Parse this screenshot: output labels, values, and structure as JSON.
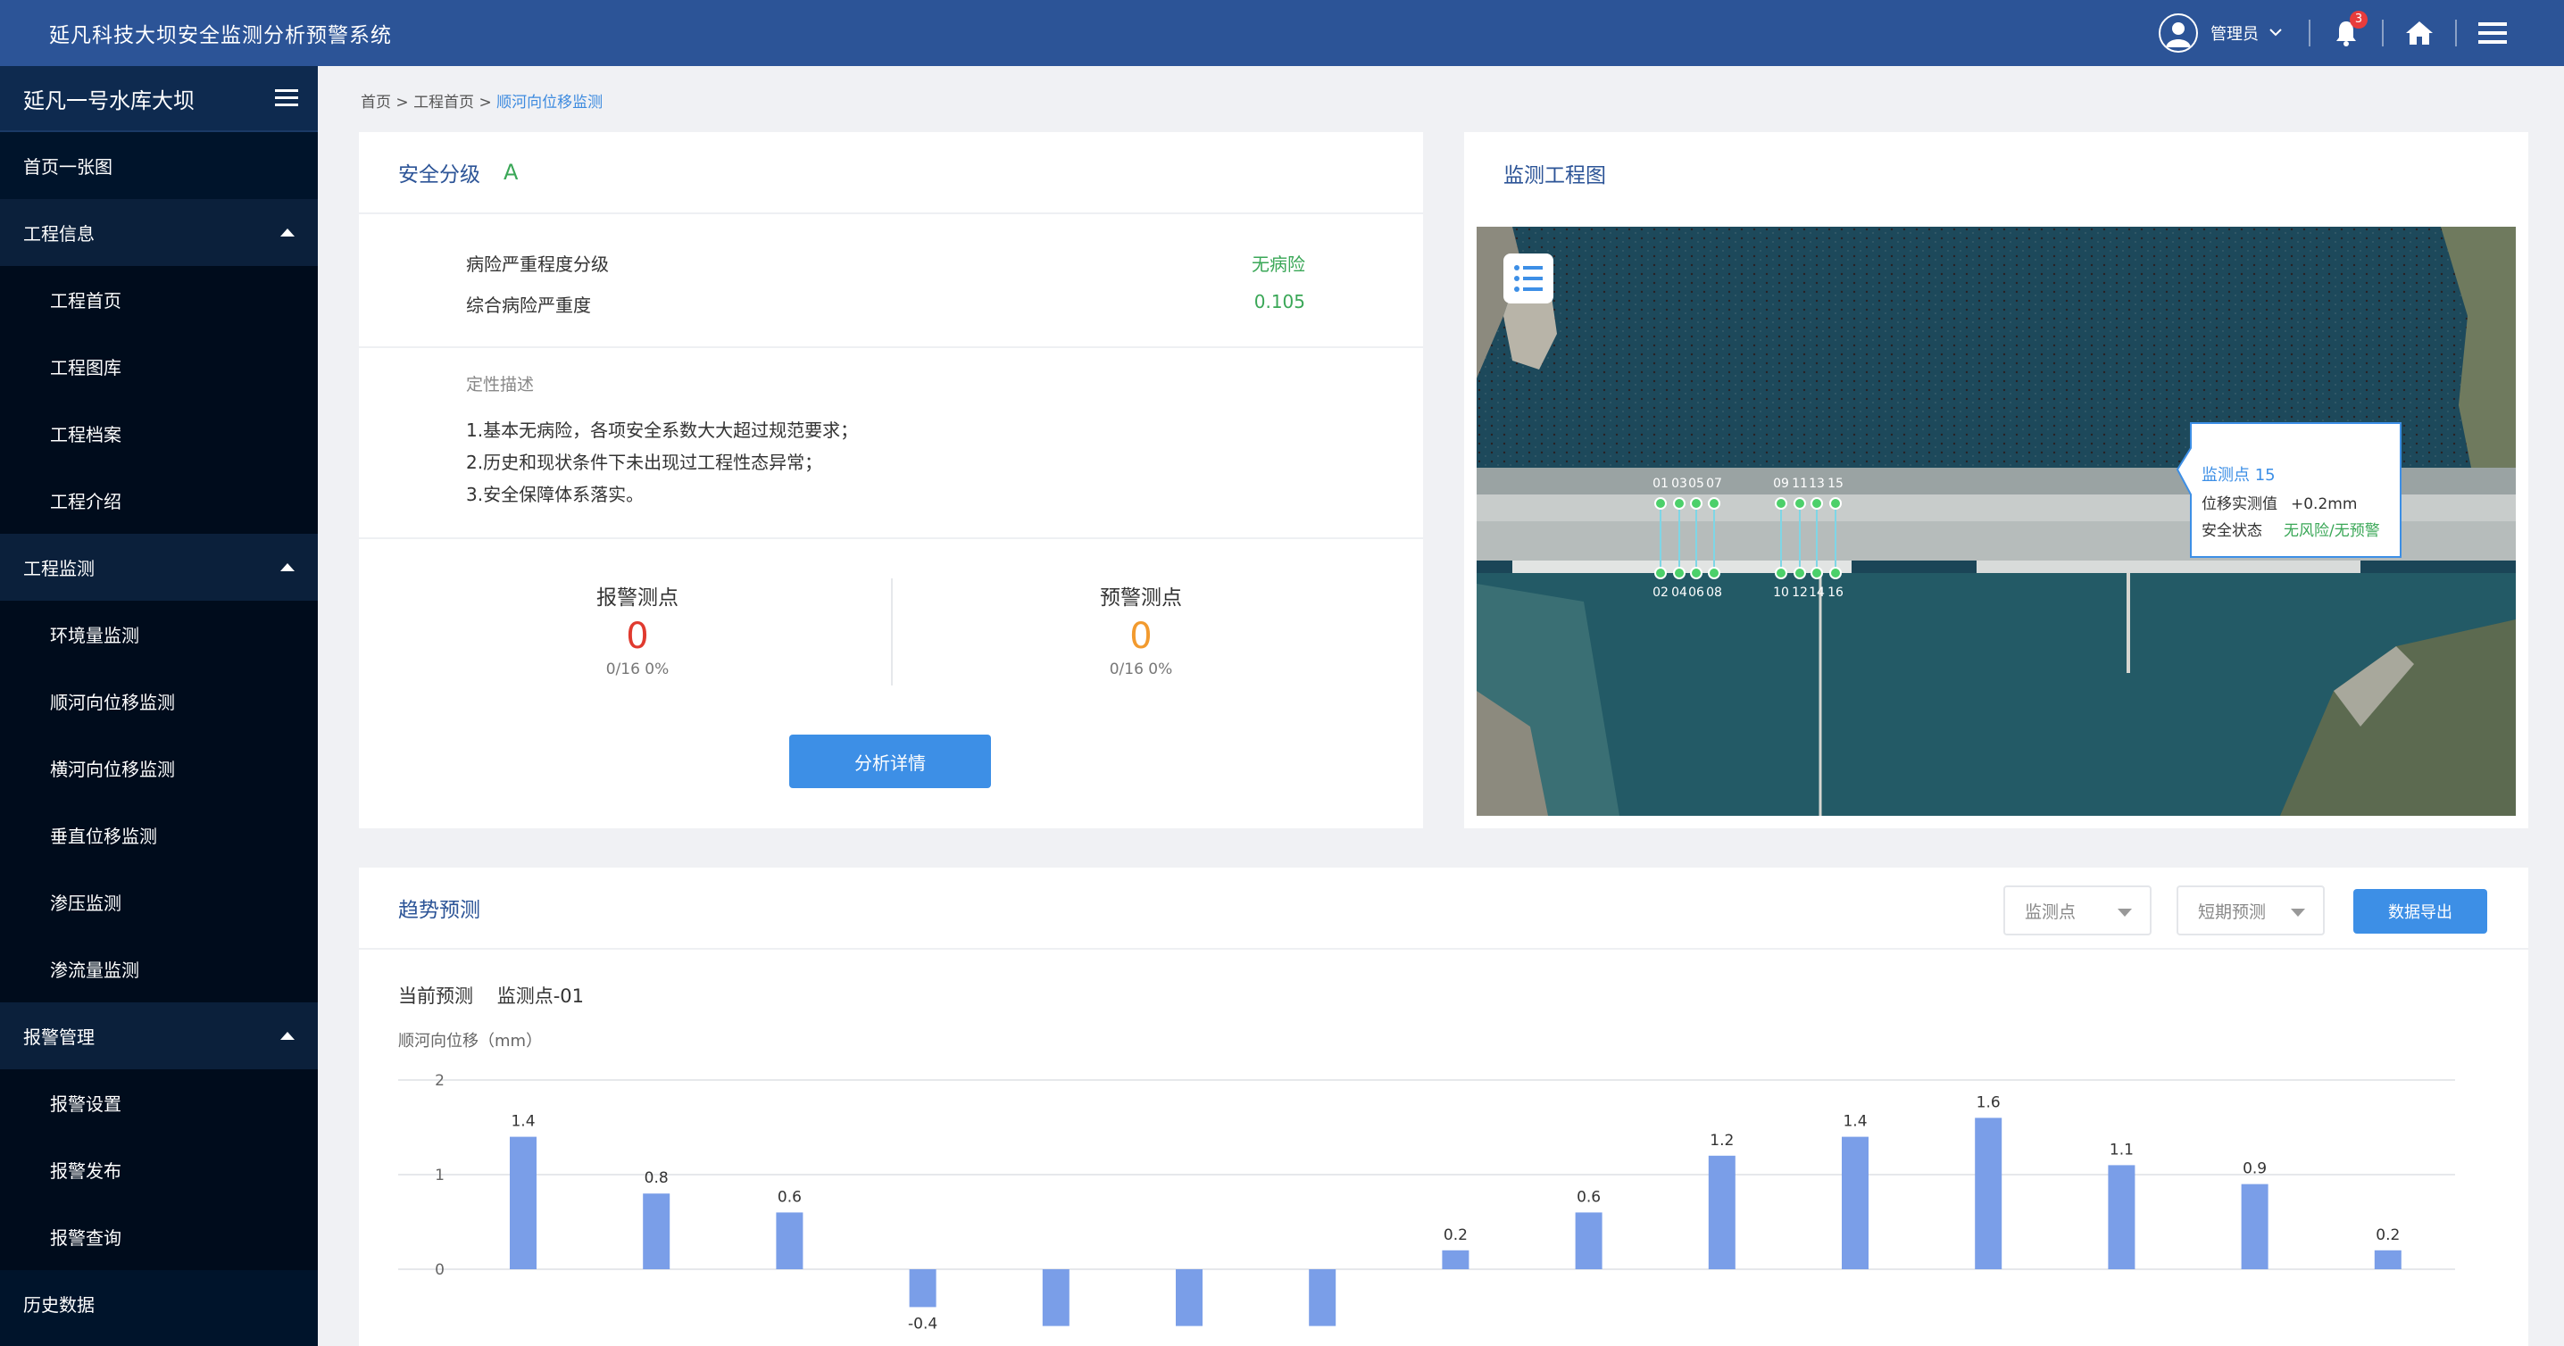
{
  "header": {
    "title": "延凡科技大坝安全监测分析预警系统",
    "user": "管理员",
    "notification_count": "3"
  },
  "sidebar": {
    "project": "延凡一号水库大坝",
    "items": [
      {
        "label": "首页一张图",
        "type": "top"
      },
      {
        "label": "工程信息",
        "type": "group"
      },
      {
        "label": "工程首页",
        "type": "sub"
      },
      {
        "label": "工程图库",
        "type": "sub"
      },
      {
        "label": "工程档案",
        "type": "sub"
      },
      {
        "label": "工程介绍",
        "type": "sub"
      },
      {
        "label": "工程监测",
        "type": "group"
      },
      {
        "label": "环境量监测",
        "type": "sub"
      },
      {
        "label": "顺河向位移监测",
        "type": "sub"
      },
      {
        "label": "横河向位移监测",
        "type": "sub"
      },
      {
        "label": "垂直位移监测",
        "type": "sub"
      },
      {
        "label": "渗压监测",
        "type": "sub"
      },
      {
        "label": "渗流量监测",
        "type": "sub"
      },
      {
        "label": "报警管理",
        "type": "group"
      },
      {
        "label": "报警设置",
        "type": "sub"
      },
      {
        "label": "报警发布",
        "type": "sub"
      },
      {
        "label": "报警查询",
        "type": "sub"
      },
      {
        "label": "历史数据",
        "type": "top"
      }
    ]
  },
  "breadcrumb": {
    "items": [
      "首页",
      "工程首页"
    ],
    "separator": ">",
    "active": "顺河向位移监测"
  },
  "safety": {
    "title": "安全分级",
    "grade": "A",
    "rows": [
      {
        "label": "病险严重程度分级",
        "value": "无病险"
      },
      {
        "label": "综合病险严重度",
        "value": "0.105"
      }
    ],
    "desc_label": "定性描述",
    "desc_lines": [
      "1.基本无病险，各项安全系数大大超过规范要求；",
      "2.历史和现状条件下未出现过工程性态异常；",
      "3.安全保障体系落实。"
    ],
    "alarm": {
      "label": "报警测点",
      "value": "0",
      "sub": "0/16   0%"
    },
    "warning": {
      "label": "预警测点",
      "value": "0",
      "sub": "0/16   0%"
    },
    "button": "分析详情"
  },
  "map": {
    "title": "监测工程图",
    "top_points": [
      "01",
      "03",
      "05",
      "07",
      "09",
      "11",
      "13",
      "15"
    ],
    "bottom_points": [
      "02",
      "04",
      "06",
      "08",
      "10",
      "12",
      "14",
      "16"
    ],
    "tooltip": {
      "title": "监测点 15",
      "row1_label": "位移实测值",
      "row1_value": "+0.2mm",
      "row2_label": "安全状态",
      "row2_value": "无风险/无预警"
    }
  },
  "trend": {
    "title": "趋势预测",
    "select1": "监测点",
    "select2": "短期预测",
    "export_button": "数据导出",
    "current_label": "当前预测",
    "current_point": "监测点-01",
    "y_axis_label": "顺河向位移（mm）"
  },
  "chart_data": {
    "type": "bar",
    "ylabel": "顺河向位移（mm）",
    "yticks": [
      2,
      1,
      0
    ],
    "values": [
      1.4,
      0.8,
      0.6,
      -0.4,
      -0.6,
      -0.6,
      -0.6,
      0.2,
      0.6,
      1.2,
      1.4,
      1.6,
      1.1,
      0.9,
      0.2
    ],
    "labels": [
      "1.4",
      "0.8",
      "0.6",
      "-0.4",
      "",
      "",
      "",
      "0.2",
      "0.6",
      "1.2",
      "1.4",
      "1.6",
      "1.1",
      "0.9",
      "0.2"
    ],
    "color": "#7a9ee8"
  },
  "colors": {
    "header_bg": "#2c5497",
    "sidebar_bg": "#00142b",
    "accent": "#3d8fe6",
    "green": "#3aa757",
    "red": "#e03a2f",
    "orange": "#f29a2e"
  }
}
